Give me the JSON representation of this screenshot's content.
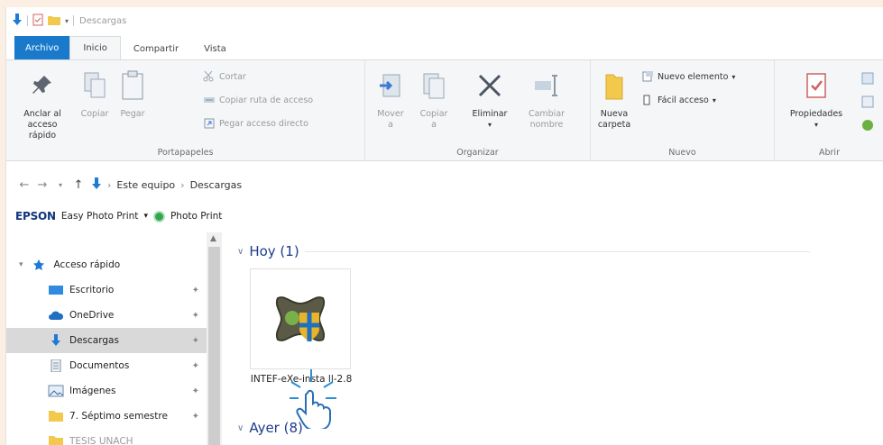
{
  "window": {
    "title": "Descargas"
  },
  "tabs": [
    {
      "label": "Archivo"
    },
    {
      "label": "Inicio"
    },
    {
      "label": "Compartir"
    },
    {
      "label": "Vista"
    }
  ],
  "ribbon": {
    "portapapeles": {
      "label": "Portapapeles",
      "pin_label": [
        "Anclar al",
        "acceso rápido"
      ],
      "copy_label": "Copiar",
      "paste_label": "Pegar",
      "cut_label": "Cortar",
      "copy_path_label": "Copiar ruta de acceso",
      "paste_shortcut_label": "Pegar acceso directo"
    },
    "organizar": {
      "label": "Organizar",
      "move_label": [
        "Mover",
        "a"
      ],
      "copy_to_label": [
        "Copiar",
        "a"
      ],
      "delete_label": "Eliminar",
      "rename_label": [
        "Cambiar",
        "nombre"
      ]
    },
    "nuevo": {
      "label": "Nuevo",
      "new_folder_label": [
        "Nueva",
        "carpeta"
      ],
      "new_item_label": "Nuevo elemento",
      "easy_access_label": "Fácil acceso"
    },
    "abrir": {
      "label": "Abrir",
      "properties_label": "Propiedades"
    }
  },
  "address": {
    "crumbs": [
      "Este equipo",
      "Descargas"
    ]
  },
  "epson": {
    "brand": "EPSON",
    "app": "Easy Photo Print",
    "photo_print": "Photo Print"
  },
  "nav": {
    "items": [
      {
        "label": "Acceso rápido"
      },
      {
        "label": "Escritorio"
      },
      {
        "label": "OneDrive"
      },
      {
        "label": "Descargas"
      },
      {
        "label": "Documentos"
      },
      {
        "label": "Imágenes"
      },
      {
        "label": "7. Séptimo semestre"
      },
      {
        "label": "TESIS UNACH"
      }
    ]
  },
  "content": {
    "groups": [
      {
        "label": "Hoy (1)"
      },
      {
        "label": "Ayer (8)"
      }
    ],
    "files": [
      {
        "name": "INTEF-eXe-insta ll-2.8"
      }
    ]
  },
  "colors": {
    "accent": "#1979ca",
    "selected_row": "#d9d9d9",
    "group_header": "#1e3c8c"
  }
}
